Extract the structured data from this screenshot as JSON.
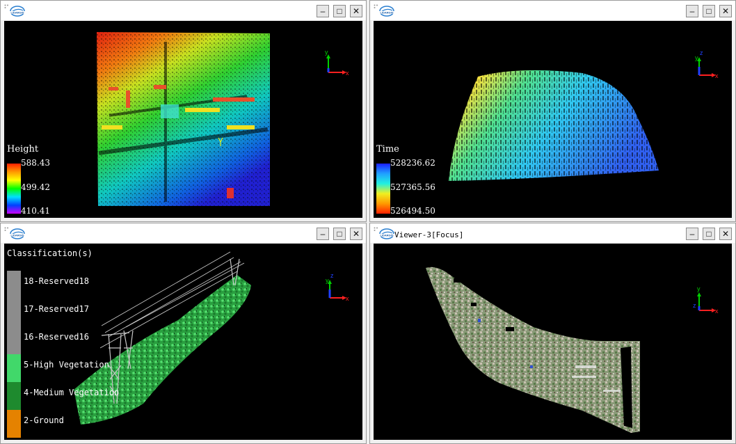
{
  "viewers": [
    {
      "title": "",
      "legend": {
        "title": "Height",
        "max": "588.43",
        "mid": "499.42",
        "min": "410.41",
        "gradient": [
          "#ff0000",
          "#ff8800",
          "#ffff00",
          "#00ff00",
          "#00ffff",
          "#0000ff",
          "#ff00ff"
        ]
      },
      "axes": {
        "x": "x",
        "y": "y"
      }
    },
    {
      "title": "",
      "legend": {
        "title": "Time",
        "max": "528236.62",
        "mid": "527365.56",
        "min": "526494.50",
        "gradient": [
          "#0000ff",
          "#00aaff",
          "#00ffee",
          "#ffff00",
          "#ff8800",
          "#ff0000"
        ]
      },
      "axes": {
        "x": "x",
        "y": "y",
        "z": "z"
      }
    },
    {
      "title": "",
      "classification": {
        "title": "Classification(s)",
        "items": [
          {
            "label": "18-Reserved18",
            "color": "#8c8c8c"
          },
          {
            "label": "17-Reserved17",
            "color": "#8c8c8c"
          },
          {
            "label": "16-Reserved16",
            "color": "#8c8c8c"
          },
          {
            "label": "5-High Vegetation",
            "color": "#41d86a"
          },
          {
            "label": "4-Medium Vegetation",
            "color": "#1e8a2e"
          },
          {
            "label": "2-Ground",
            "color": "#e58200"
          }
        ]
      },
      "axes": {
        "x": "x",
        "y": "y",
        "z": "z"
      }
    },
    {
      "title": "Viewer-3[Focus]",
      "axes": {
        "x": "x",
        "y": "y",
        "z": "z"
      }
    }
  ],
  "window_controls": {
    "minimize": "–",
    "maximize": "□",
    "close": "✕"
  },
  "logo_text": "LiDARGIS"
}
